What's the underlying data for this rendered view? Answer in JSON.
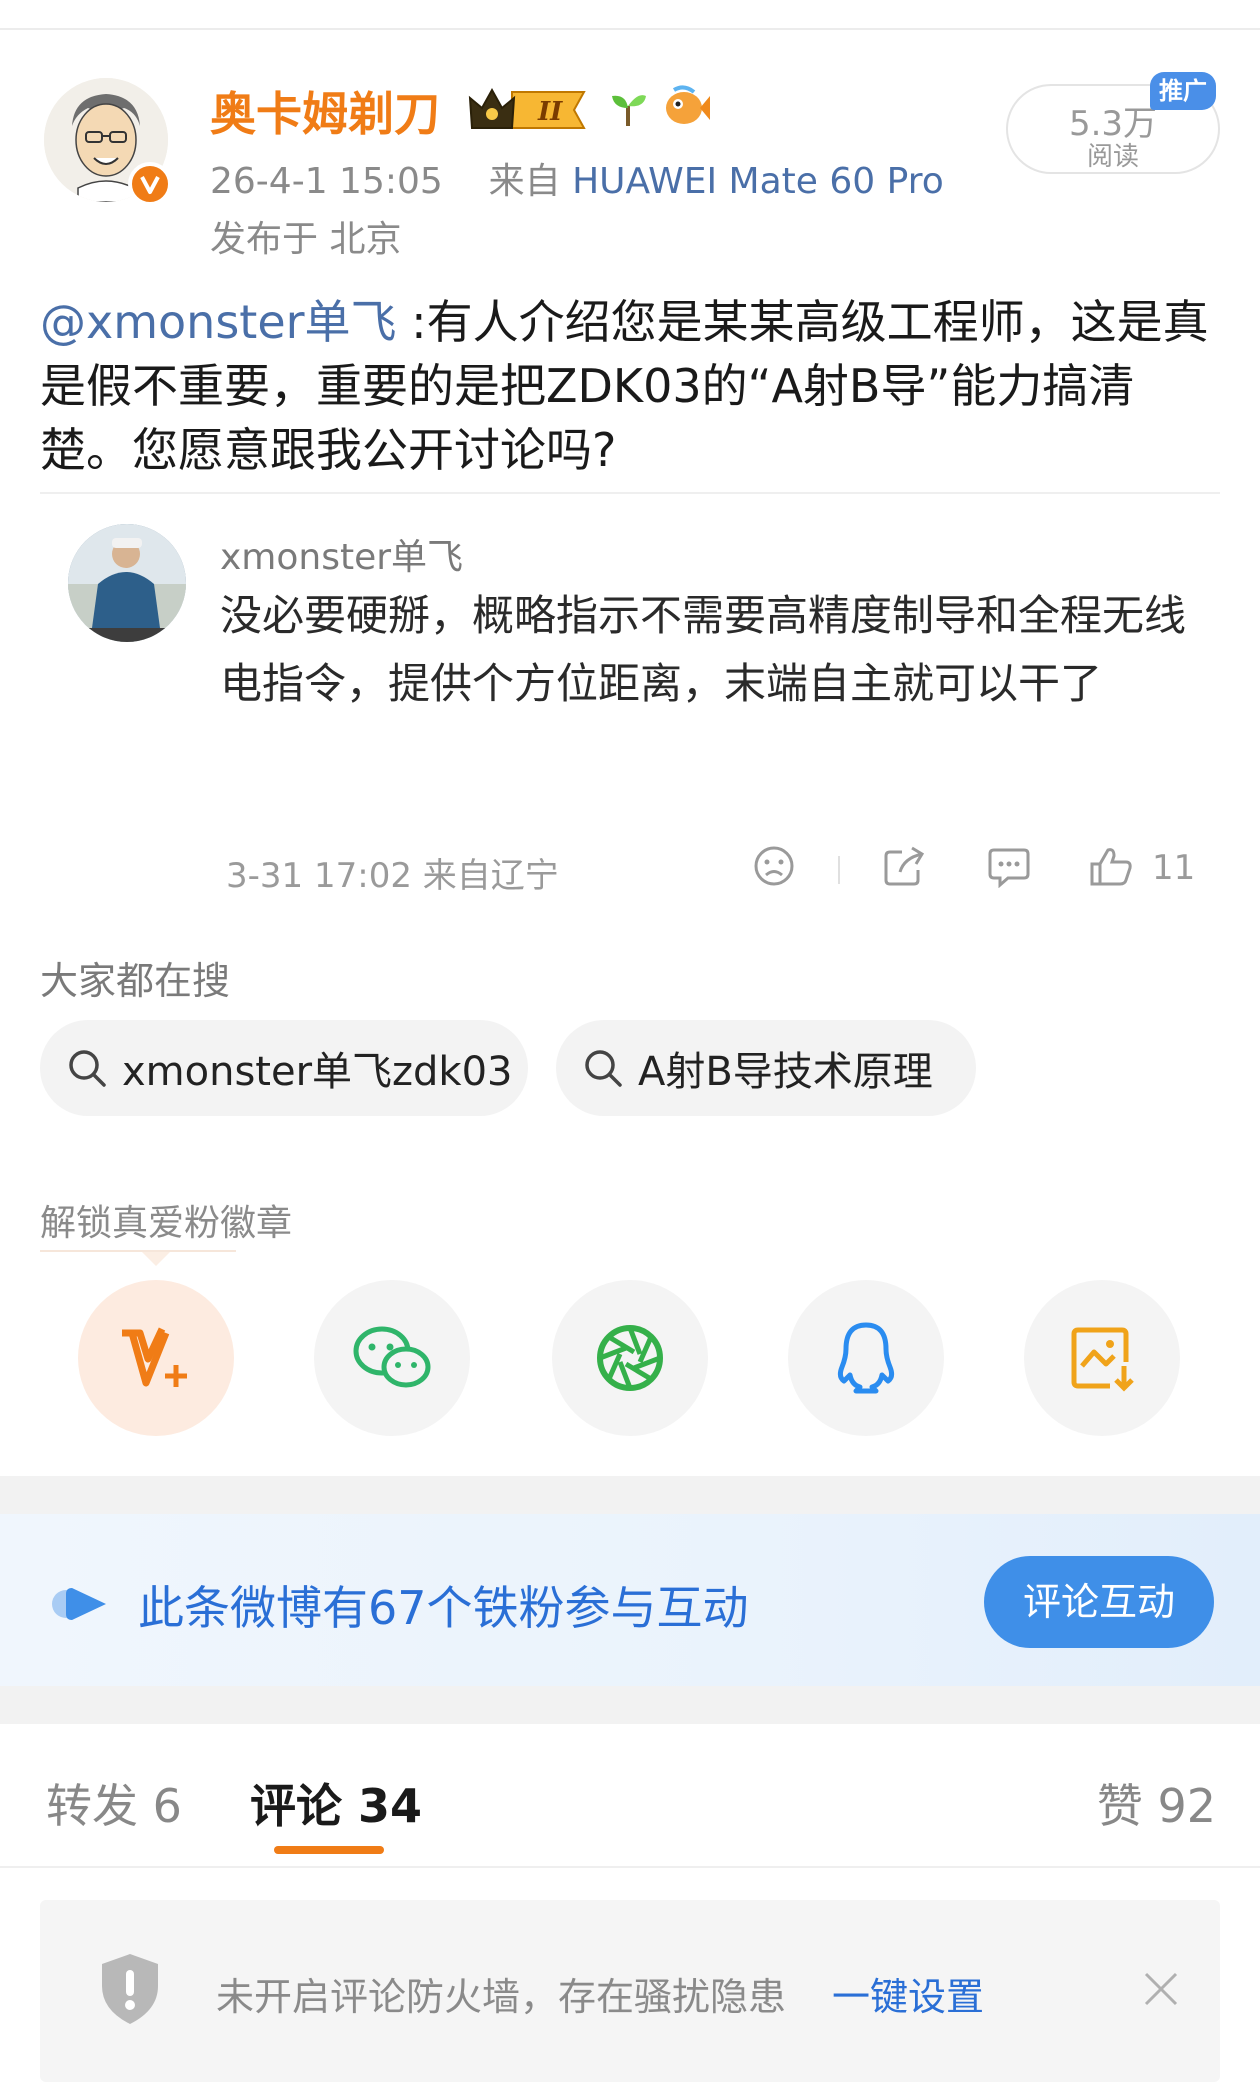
{
  "post": {
    "author": "奥卡姆剃刀",
    "date_time": "26-4-1 15:05",
    "source_prefix": "来自",
    "device": "HUAWEI Mate 60 Pro",
    "location": "发布于 北京",
    "reads_count": "5.3万",
    "reads_label": "阅读",
    "promo_tag": "推广",
    "mention": "@xmonster单飞",
    "body": " :有人介绍您是某某高级工程师，这是真是假不重要，重要的是把ZDK03的“A射B导”能力搞清楚。您愿意跟我公开讨论吗?"
  },
  "quoted_comment": {
    "name": "xmonster单飞",
    "text": "没必要硬掰，概略指示不需要高精度制导和全程无线电指令，提供个方位距离，末端自主就可以干了",
    "meta": "3-31 17:02  来自辽宁",
    "like_count": "11"
  },
  "search": {
    "title": "大家都在搜",
    "chips": [
      "xmonster单飞zdk03",
      "A射B导技术原理"
    ]
  },
  "unlock": {
    "title": "解锁真爱粉徽章"
  },
  "fans_banner": {
    "text": "此条微博有67个铁粉参与互动",
    "button": "评论互动"
  },
  "tabs": {
    "repost": "转发 6",
    "comments": "评论 34",
    "likes": "赞 92"
  },
  "notice": {
    "text": "未开启评论防火墙，存在骚扰隐患",
    "link": "一键设置"
  },
  "colors": {
    "brand_orange": "#f07c16",
    "link_blue": "#4a6fa8",
    "action_blue": "#3f8fe8"
  }
}
